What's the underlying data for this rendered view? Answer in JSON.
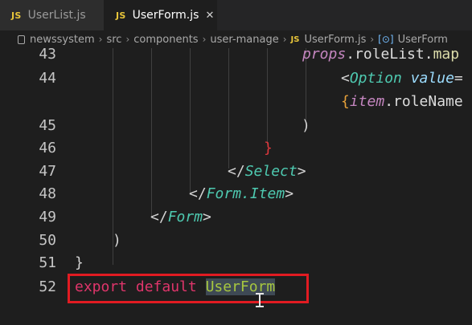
{
  "tabs": [
    {
      "icon": "JS",
      "label": "UserList.js",
      "active": false
    },
    {
      "icon": "JS",
      "label": "UserForm.js",
      "active": true,
      "close": "✕"
    }
  ],
  "breadcrumb": {
    "items": [
      "newssystem",
      "src",
      "components",
      "user-manage"
    ],
    "file_icon": "JS",
    "file": "UserForm.js",
    "symbol_icon": "[⊙]",
    "symbol": "UserForm",
    "separator": "›"
  },
  "editor": {
    "lines": [
      {
        "num": "43",
        "tokens": [
          {
            "t": "props",
            "c": "kw-props"
          },
          {
            "t": ".roleList.",
            "c": "ident"
          },
          {
            "t": "map",
            "c": "method"
          }
        ]
      },
      {
        "num": "44",
        "tokens": [
          {
            "t": "<",
            "c": "tag-bracket"
          },
          {
            "t": "Option",
            "c": "tag-name"
          },
          {
            "t": " ",
            "c": "punct"
          },
          {
            "t": "value",
            "c": "attr"
          },
          {
            "t": "=",
            "c": "punct"
          }
        ]
      },
      {
        "num": "",
        "tokens": [
          {
            "t": "{",
            "c": "brace-orange"
          },
          {
            "t": "item",
            "c": "kw-props"
          },
          {
            "t": ".roleName",
            "c": "ident"
          }
        ]
      },
      {
        "num": "45",
        "tokens": [
          {
            "t": ")",
            "c": "punct"
          }
        ]
      },
      {
        "num": "46",
        "tokens": [
          {
            "t": "}",
            "c": "brace-red"
          }
        ]
      },
      {
        "num": "47",
        "tokens": [
          {
            "t": "</",
            "c": "tag-bracket"
          },
          {
            "t": "Select",
            "c": "tag-name"
          },
          {
            "t": ">",
            "c": "tag-bracket"
          }
        ]
      },
      {
        "num": "48",
        "tokens": [
          {
            "t": "</",
            "c": "tag-bracket"
          },
          {
            "t": "Form.Item",
            "c": "tag-name"
          },
          {
            "t": ">",
            "c": "tag-bracket"
          }
        ]
      },
      {
        "num": "49",
        "tokens": [
          {
            "t": "</",
            "c": "tag-bracket"
          },
          {
            "t": "Form",
            "c": "tag-name"
          },
          {
            "t": ">",
            "c": "tag-bracket"
          }
        ]
      },
      {
        "num": "50",
        "tokens": [
          {
            "t": ")",
            "c": "punct"
          }
        ]
      },
      {
        "num": "51",
        "tokens": [
          {
            "t": "}",
            "c": "punct"
          }
        ]
      },
      {
        "num": "52",
        "tokens": [
          {
            "t": "export default ",
            "c": "kw-export"
          },
          {
            "t": "UserForm",
            "c": "sel-word"
          }
        ]
      }
    ]
  },
  "colors": {
    "background": "#1e1e1e",
    "highlight_box": "#e11b22",
    "js_icon": "#e8c53a"
  }
}
